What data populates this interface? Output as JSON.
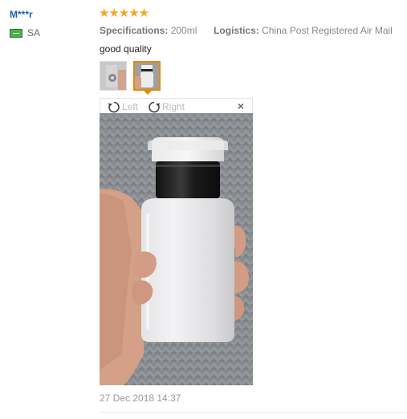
{
  "review": {
    "user_name": "M***r",
    "country_code": "SA",
    "stars": "★★★★★",
    "rating": 5,
    "spec_label": "Specifications:",
    "spec_value": "200ml",
    "logistics_label": "Logistics:",
    "logistics_value": "China Post Registered Air Mail",
    "text": "good quality",
    "date": "27 Dec 2018 14:37"
  },
  "viewer": {
    "rotate_left_label": "Left",
    "rotate_right_label": "Right",
    "close_symbol": "×",
    "selected_thumb": 2
  },
  "icons": {
    "flag": "flag-icon",
    "rotate_left": "rotate-left-icon",
    "rotate_right": "rotate-right-icon",
    "close": "close-icon"
  },
  "colors": {
    "username": "#1a5fb4",
    "star": "#f5a623",
    "thumb_selected": "#e68a00"
  }
}
